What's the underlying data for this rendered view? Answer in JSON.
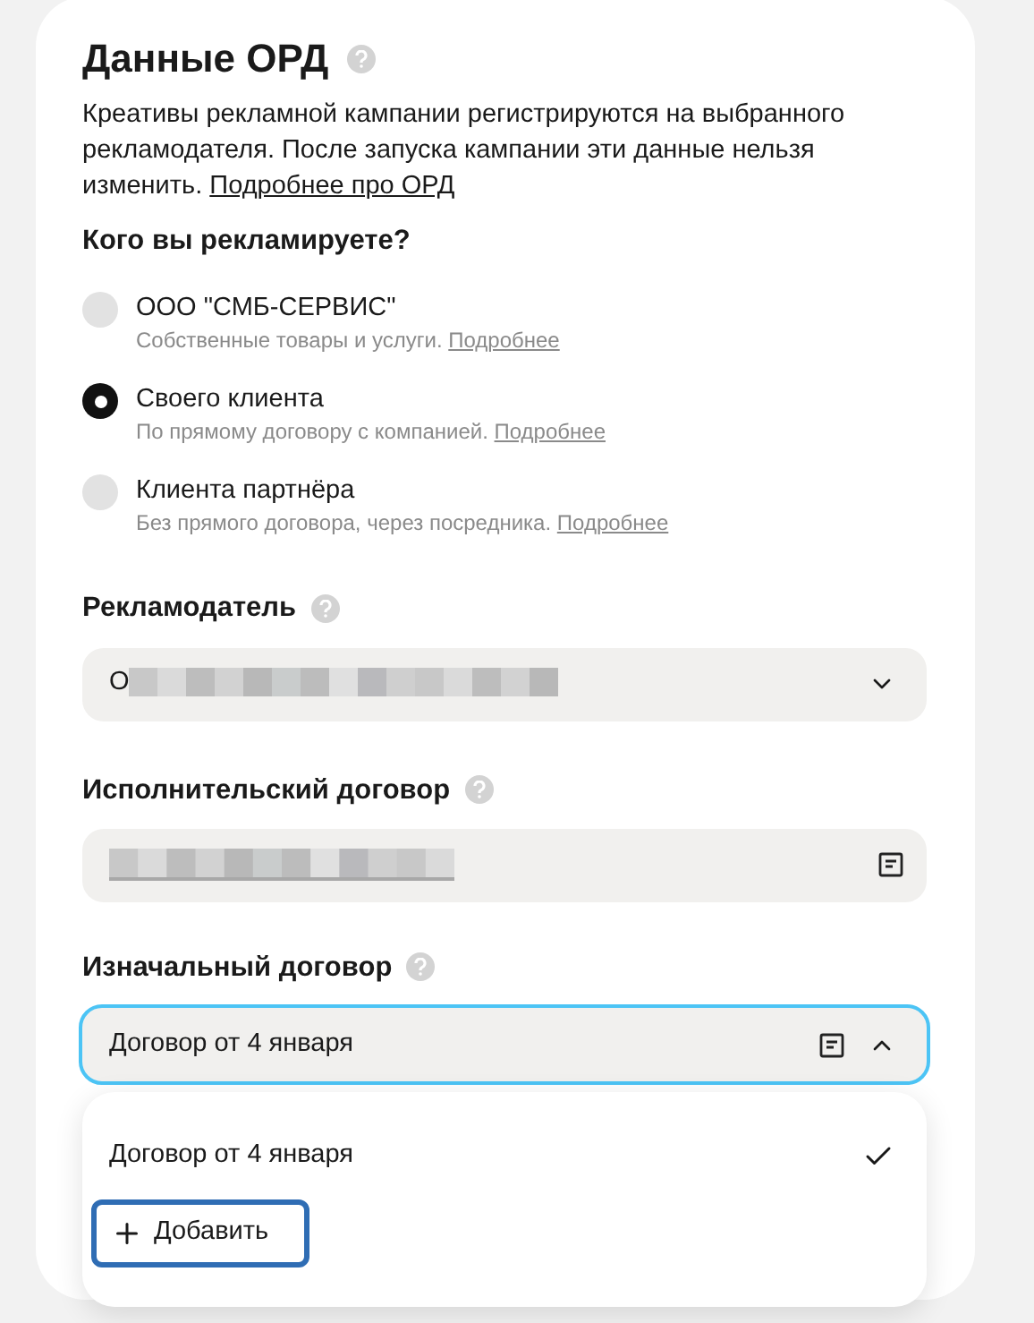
{
  "title": "Данные ОРД",
  "description": {
    "text": "Креативы рекламной кампании регистрируются на выбранного рекламодателя. После запуска кампании эти данные нельзя изменить.",
    "link": "Подробнее про ОРД"
  },
  "question": "Кого вы рекламируете?",
  "options": [
    {
      "label": "ООО \"СМБ-СЕРВИС\"",
      "hint": "Собственные товары и услуги.",
      "link": "Подробнее",
      "selected": false
    },
    {
      "label": "Своего клиента",
      "hint": "По прямому договору с компанией.",
      "link": "Подробнее",
      "selected": true
    },
    {
      "label": "Клиента партнёра",
      "hint": "Без прямого договора, через посредника.",
      "link": "Подробнее",
      "selected": false
    }
  ],
  "advertiser": {
    "label": "Рекламодатель",
    "value": "О"
  },
  "executive_contract": {
    "label": "Исполнительский договор"
  },
  "initial_contract": {
    "label": "Изначальный договор",
    "value": "Договор от 4 января",
    "expanded": true,
    "menu": {
      "items": [
        {
          "label": "Договор от 4 января",
          "selected": true
        }
      ],
      "add_button": "Добавить"
    }
  }
}
